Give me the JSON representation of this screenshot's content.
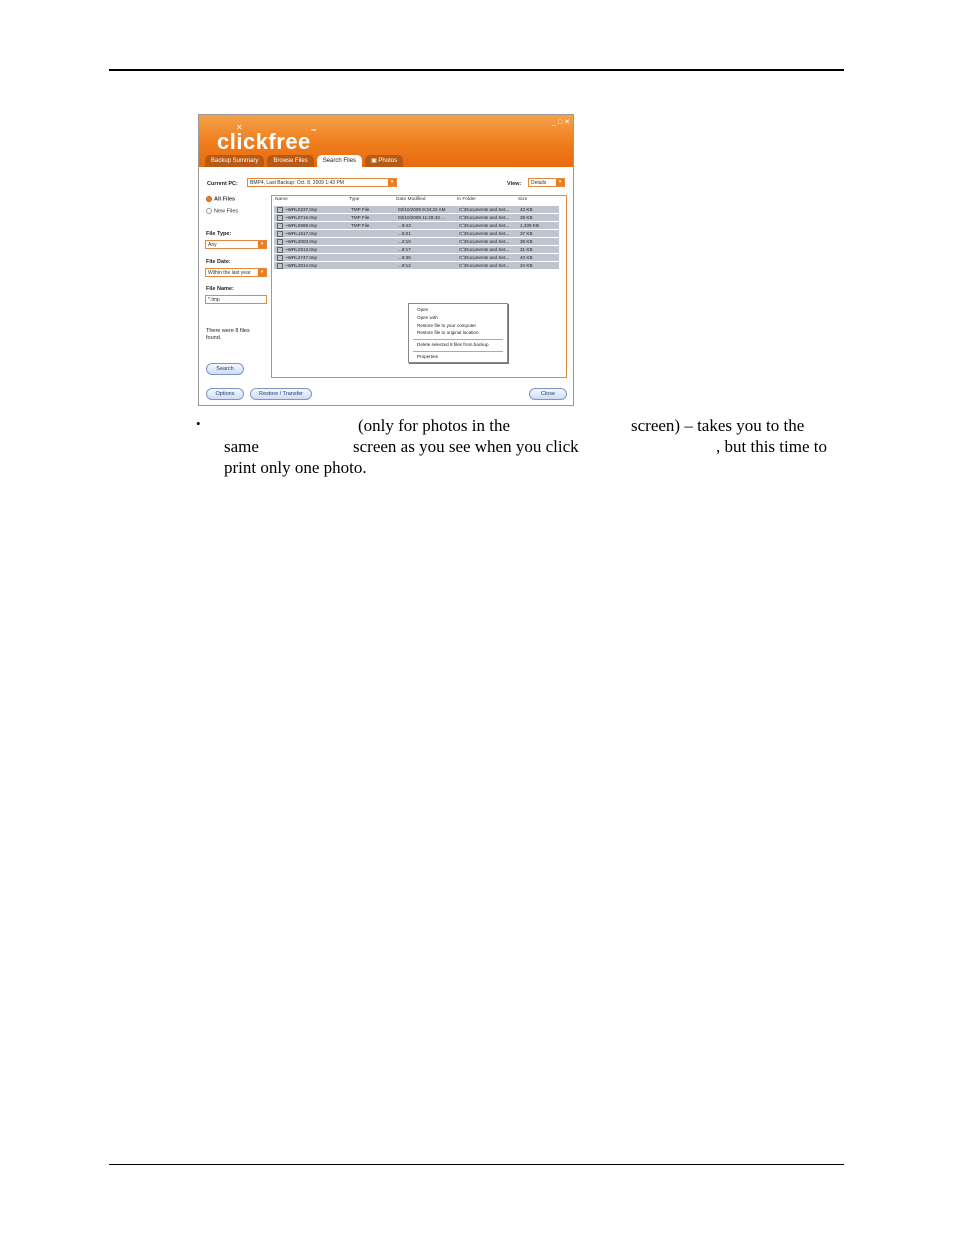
{
  "app": {
    "logo": "clickfree",
    "tabs": [
      "Backup Summary",
      "Browse Files",
      "Search Files",
      "Photos"
    ],
    "current_pc_label": "Current PC:",
    "current_pc_value": "BMP4, Last Backup: Oct. 8, 2009 1:43 PM",
    "view_label": "View:",
    "view_value": "Details",
    "radio_all": "All Files",
    "radio_new": "New Files",
    "file_type_label": "File Type:",
    "file_type_value": "Any",
    "file_date_label": "File Date:",
    "file_date_value": "Within the last year",
    "file_name_label": "File Name:",
    "file_name_value": "*.tmp",
    "found_text": "There were 8 files found.",
    "search_button": "Search",
    "options_button": "Options",
    "restore_button": "Restore / Transfer",
    "close_button": "Close",
    "columns": [
      "Name",
      "Type",
      "Date Modified",
      "In Folder",
      "Size"
    ],
    "rows": [
      {
        "name": "~WRL0237.tmp",
        "type": "TMP File",
        "date": "03/10/2009 9:34:22 AM",
        "folder": "C:\\Documents and Set...",
        "size": "42 KB"
      },
      {
        "name": "~WRL0716.tmp",
        "type": "TMP File",
        "date": "03/10/2009 11:29:43 ...",
        "folder": "C:\\Documents and Set...",
        "size": "39 KB"
      },
      {
        "name": "~WRL0999.tmp",
        "type": "TMP File",
        "date": "...9:43",
        "folder": "C:\\Documents and Set...",
        "size": "1,339 KB"
      },
      {
        "name": "~WRL1517.tmp",
        "type": "",
        "date": "...5:01",
        "folder": "C:\\Documents and Set...",
        "size": "37 KB"
      },
      {
        "name": "~WRL2003.tmp",
        "type": "",
        "date": "...2:10",
        "folder": "C:\\Documents and Set...",
        "size": "38 KB"
      },
      {
        "name": "~WRL2513.tmp",
        "type": "",
        "date": "...8:17",
        "folder": "C:\\Documents and Set...",
        "size": "31 KB"
      },
      {
        "name": "~WRL2747.tmp",
        "type": "",
        "date": "...8:35",
        "folder": "C:\\Documents and Set...",
        "size": "40 KB"
      },
      {
        "name": "~WRL3014.tmp",
        "type": "",
        "date": "...9:12",
        "folder": "C:\\Documents and Set...",
        "size": "34 KB"
      }
    ],
    "context_menu": [
      "Open",
      "Open with",
      "Restore file to your computer",
      "Restore file to original location",
      "Delete selected 8 files from backup",
      "Properties"
    ]
  },
  "text": {
    "bullet": "•",
    "line1_a": "(only for photos in the",
    "line1_b": "screen) – takes you to the",
    "line2_a": "same",
    "line2_b": "screen as you see when you click",
    "line2_c": ", but this time to",
    "line3": "print only one photo."
  }
}
